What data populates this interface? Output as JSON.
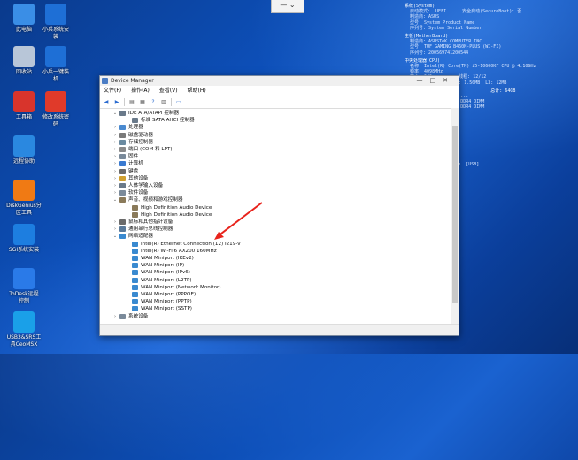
{
  "desktop": {
    "icons": [
      {
        "label": "此电脑",
        "color": "#3a8ee6"
      },
      {
        "label": "小兵系统安\n装",
        "color": "#1e6fd6"
      },
      {
        "label": "回收站",
        "color": "#b8c6d8"
      },
      {
        "label": "小兵一键装\n机",
        "color": "#1e6fd6"
      },
      {
        "label": "工具箱",
        "color": "#d8342c"
      },
      {
        "label": "修改系统密\n码",
        "color": "#e03a2a"
      },
      {
        "label": "远程协助",
        "color": "#2a88e0"
      },
      {
        "label": "DiskGenius分\n区工具",
        "color": "#f07a14"
      },
      {
        "label": "SGI系统安装",
        "color": "#1d7ee0"
      },
      {
        "label": "ToDesk远程\n控制",
        "color": "#2a7ae8"
      },
      {
        "label": "USB3&SRS工\n具CeoMSX",
        "color": "#1aa0e8"
      }
    ]
  },
  "topbar": {
    "label": "— ⌄"
  },
  "sysinfo": {
    "blocks": [
      {
        "lines": [
          "系统(System)",
          "  启动模式:  UEFI      安全启动(SecureBoot): 否",
          "  制造商: ASUS",
          "  型号: System Product Name",
          "  序列号: System Serial Number"
        ]
      },
      {
        "lines": [
          "主板(MotherBoard)",
          "  制造商: ASUSTeK COMPUTER INC.",
          "  型号: TUF GAMING B460M-PLUS (WI-FI)",
          "  序列号: 200569741200544"
        ]
      },
      {
        "lines": [
          "中央处理器(CPU)",
          "  名称: Intel(R) Core(TM) i5-10600KF CPU @ 4.10GHz",
          "  频率: 4098MHz",
          "  核心: 6/6          线程: 12/12",
          "  缓存: L1: 384KB  L2: 1.50MB  L3: 12MB"
        ]
      },
      {
        "lines": [
          "内存(RAM)                        总计: 64GB",
          "  [1]: 16GB(2133MHz) ...",
          "  [2]: 16GB ...      DDR4 DIMM",
          "  [3]: ...           DDR4 DIMM"
        ]
      },
      {
        "lines": [
          "硬盘(Disk)",
          "  [SATA]",
          "  [  C  ]",
          "  [  D  ]",
          "  [  E  ]",
          "  [NVMe]",
          "  SSD 500GB  [NVMe]",
          "  [  F  ]",
          "  [  G  ]",
          "  [USB] ...USB Device  [USB]",
          "  [  X  ]"
        ]
      }
    ]
  },
  "window": {
    "title": "Device Manager",
    "menu": [
      "文件(F)",
      "操作(A)",
      "查看(V)",
      "帮助(H)"
    ],
    "buttons": [
      "—",
      "□",
      "✕"
    ],
    "tree": [
      {
        "text": "IDE ATA/ATAPI 控制器",
        "level": 1,
        "exp": "⌄",
        "color": "#6a7a8a"
      },
      {
        "text": "标准 SATA AHCI 控制器",
        "level": 2,
        "exp": "",
        "color": "#6a7a8a"
      },
      {
        "text": "处理器",
        "level": 1,
        "exp": "›",
        "color": "#4a8ad0"
      },
      {
        "text": "磁盘驱动器",
        "level": 1,
        "exp": "›",
        "color": "#7a7a7a"
      },
      {
        "text": "存储控制器",
        "level": 1,
        "exp": "›",
        "color": "#6a8aa0"
      },
      {
        "text": "端口 (COM 和 LPT)",
        "level": 1,
        "exp": "›",
        "color": "#8a8a8a"
      },
      {
        "text": "固件",
        "level": 1,
        "exp": "›",
        "color": "#7a8a9a"
      },
      {
        "text": "计算机",
        "level": 1,
        "exp": "›",
        "color": "#3a7ad0"
      },
      {
        "text": "键盘",
        "level": 1,
        "exp": "›",
        "color": "#6a6a6a"
      },
      {
        "text": "其他设备",
        "level": 1,
        "exp": "›",
        "color": "#d0a030"
      },
      {
        "text": "人体学输入设备",
        "level": 1,
        "exp": "›",
        "color": "#6a7a8a"
      },
      {
        "text": "软件设备",
        "level": 1,
        "exp": "›",
        "color": "#7a8a9a"
      },
      {
        "text": "声音、视频和游戏控制器",
        "level": 1,
        "exp": "⌄",
        "color": "#8a7a5a"
      },
      {
        "text": "High Definition Audio Device",
        "level": 2,
        "exp": "",
        "color": "#8a7a5a"
      },
      {
        "text": "High Definition Audio Device",
        "level": 2,
        "exp": "",
        "color": "#8a7a5a"
      },
      {
        "text": "鼠标和其他指针设备",
        "level": 1,
        "exp": "›",
        "color": "#6a6a6a"
      },
      {
        "text": "通用串行总线控制器",
        "level": 1,
        "exp": "›",
        "color": "#5a7a9a"
      },
      {
        "text": "网络适配器",
        "level": 1,
        "exp": "⌄",
        "color": "#3a8ad0"
      },
      {
        "text": "Intel(R) Ethernet Connection (12) I219-V",
        "level": 2,
        "exp": "",
        "color": "#3a8ad0"
      },
      {
        "text": "Intel(R) Wi-Fi 6 AX200 160MHz",
        "level": 2,
        "exp": "",
        "color": "#3a8ad0"
      },
      {
        "text": "WAN Miniport (IKEv2)",
        "level": 2,
        "exp": "",
        "color": "#3a8ad0"
      },
      {
        "text": "WAN Miniport (IP)",
        "level": 2,
        "exp": "",
        "color": "#3a8ad0"
      },
      {
        "text": "WAN Miniport (IPv6)",
        "level": 2,
        "exp": "",
        "color": "#3a8ad0"
      },
      {
        "text": "WAN Miniport (L2TP)",
        "level": 2,
        "exp": "",
        "color": "#3a8ad0"
      },
      {
        "text": "WAN Miniport (Network Monitor)",
        "level": 2,
        "exp": "",
        "color": "#3a8ad0"
      },
      {
        "text": "WAN Miniport (PPPOE)",
        "level": 2,
        "exp": "",
        "color": "#3a8ad0"
      },
      {
        "text": "WAN Miniport (PPTP)",
        "level": 2,
        "exp": "",
        "color": "#3a8ad0"
      },
      {
        "text": "WAN Miniport (SSTP)",
        "level": 2,
        "exp": "",
        "color": "#3a8ad0"
      },
      {
        "text": "系统设备",
        "level": 1,
        "exp": "›",
        "color": "#7a8a9a"
      }
    ]
  },
  "annotation": {
    "color": "#e8231c"
  }
}
